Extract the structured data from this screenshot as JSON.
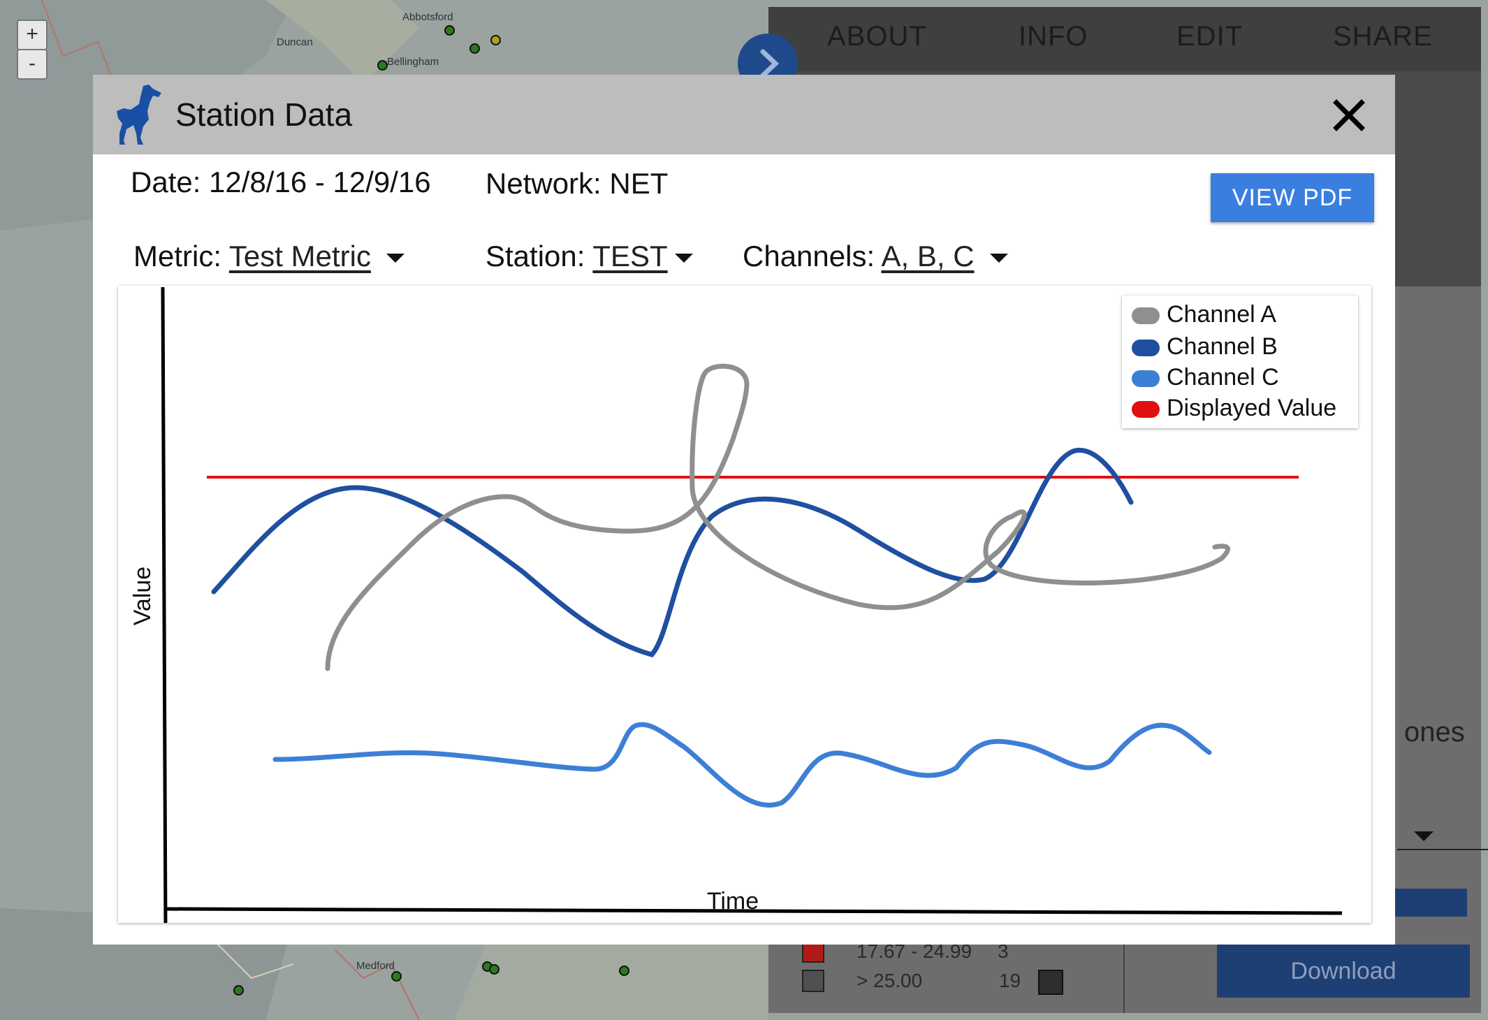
{
  "map": {
    "zoom_in_label": "+",
    "zoom_out_label": "-",
    "places": [
      "Abbotsford",
      "Duncan",
      "Bellingham",
      "Medford"
    ]
  },
  "nav": {
    "items": [
      "ABOUT",
      "INFO",
      "EDIT",
      "SHARE"
    ]
  },
  "background_panel": {
    "partial_text": "ones",
    "download_label": "Download",
    "legend_rows": [
      {
        "range": "17.67 - 24.99",
        "count": "3"
      },
      {
        "range": "> 25.00",
        "count": "19"
      }
    ]
  },
  "modal": {
    "title": "Station Data",
    "logo_icon": "horse-logo-icon",
    "date_label": "Date: 12/8/16 - 12/9/16",
    "network_label": "Network: NET",
    "view_pdf_label": "VIEW PDF",
    "metric_label": "Metric:",
    "metric_value": "Test Metric",
    "station_label": "Station:",
    "station_value": "TEST",
    "channels_label": "Channels:",
    "channels_value": "A, B, C"
  },
  "chart_data": {
    "type": "line",
    "title": "",
    "xlabel": "Time",
    "ylabel": "Value",
    "grid": false,
    "legend_position": "top-right",
    "series": [
      {
        "name": "Channel A",
        "color": "#8f8f8f"
      },
      {
        "name": "Channel B",
        "color": "#1f4fa0"
      },
      {
        "name": "Channel C",
        "color": "#3d7fd6"
      },
      {
        "name": "Displayed Value",
        "color": "#e01010"
      }
    ]
  }
}
